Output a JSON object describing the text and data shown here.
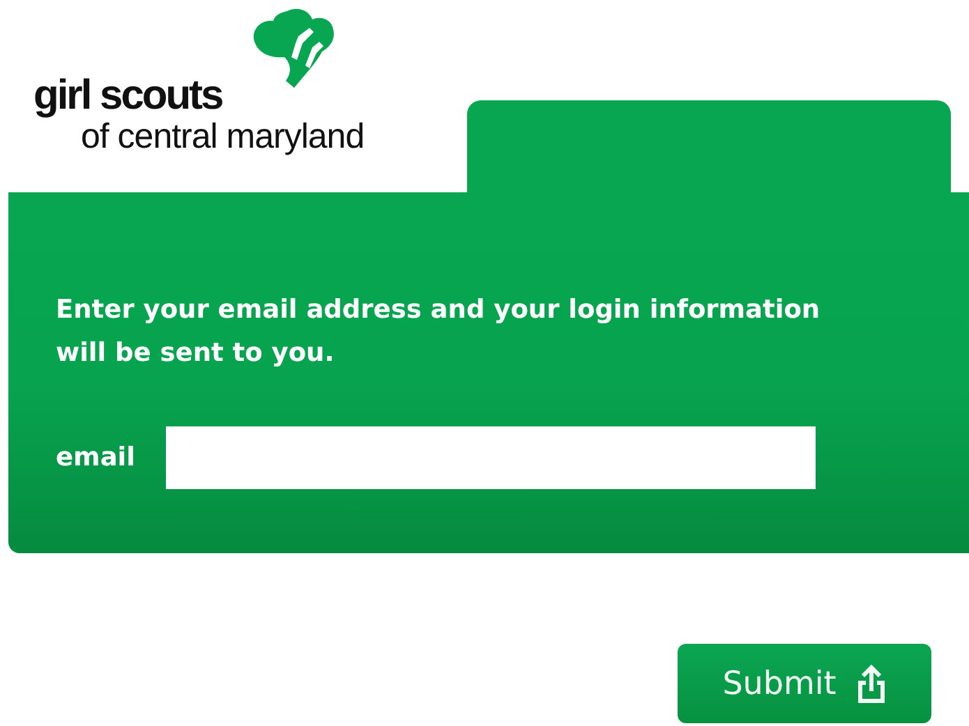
{
  "logo": {
    "name": "girl scouts",
    "subtitle": "of central maryland"
  },
  "form": {
    "instructions": "Enter your email address and your login information will be sent to you.",
    "email_label": "email"
  },
  "submit_button": {
    "label": "Submit"
  }
}
